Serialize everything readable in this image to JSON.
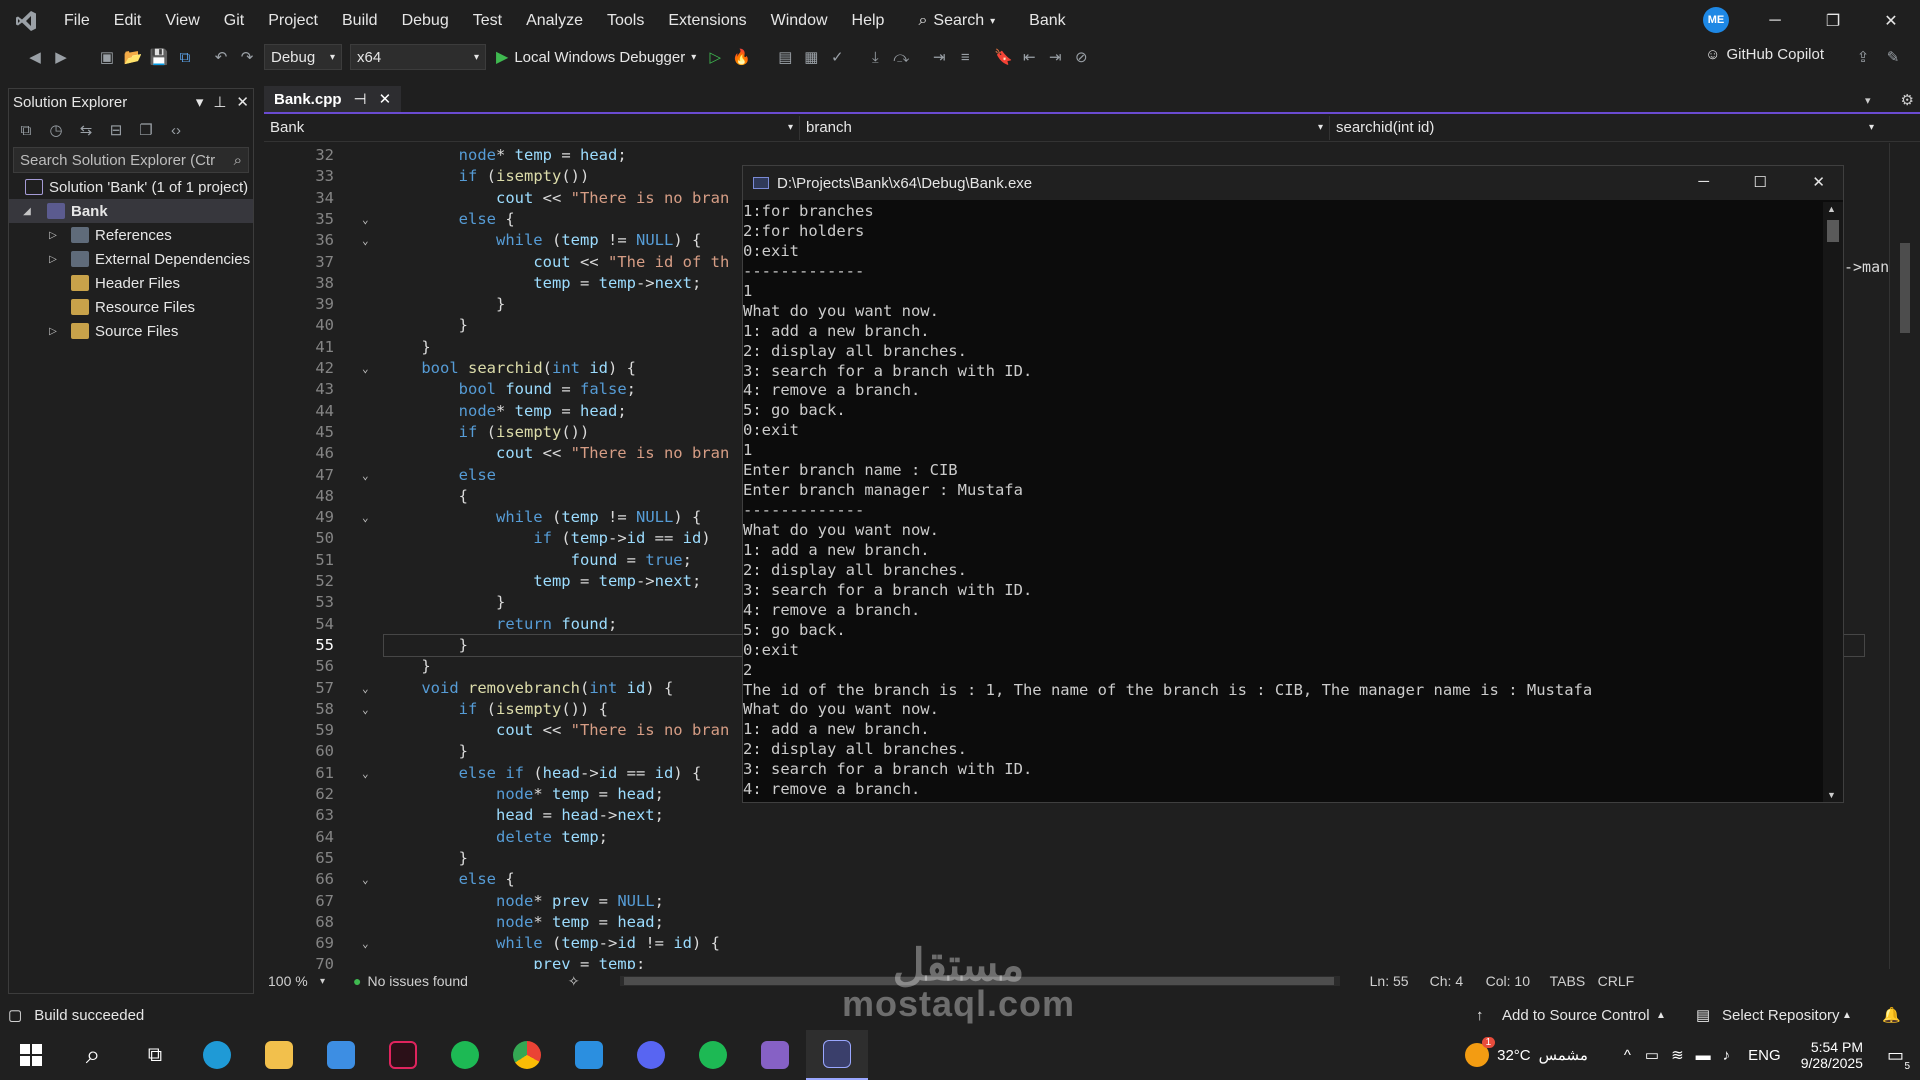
{
  "menu": {
    "items": [
      "File",
      "Edit",
      "View",
      "Git",
      "Project",
      "Build",
      "Debug",
      "Test",
      "Analyze",
      "Tools",
      "Extensions",
      "Window",
      "Help"
    ],
    "search_label": "Search",
    "app_title": "Bank",
    "avatar": "ME"
  },
  "toolbar": {
    "config": "Debug",
    "platform": "x64",
    "run_label": "Local Windows Debugger",
    "copilot": "GitHub Copilot"
  },
  "solution_explorer": {
    "title": "Solution Explorer",
    "search_placeholder": "Search Solution Explorer (Ctr",
    "solution": "Solution 'Bank' (1 of 1 project)",
    "project": "Bank",
    "items": [
      "References",
      "External Dependencies",
      "Header Files",
      "Resource Files",
      "Source Files"
    ]
  },
  "editor": {
    "tab": "Bank.cpp",
    "nav_scope": "Bank",
    "nav_class": "branch",
    "nav_member": "searchid(int id)",
    "lines": [
      {
        "n": "32",
        "t": "        node* temp = head;"
      },
      {
        "n": "33",
        "t": "        if (isempty())"
      },
      {
        "n": "34",
        "t": "            cout << \"There is no bran"
      },
      {
        "n": "35",
        "t": "        else {"
      },
      {
        "n": "36",
        "t": "            while (temp != NULL) {"
      },
      {
        "n": "37",
        "t": "                cout << \"The id of th"
      },
      {
        "n": "38",
        "t": "                temp = temp->next;"
      },
      {
        "n": "39",
        "t": "            }"
      },
      {
        "n": "40",
        "t": "        }"
      },
      {
        "n": "41",
        "t": "    }"
      },
      {
        "n": "42",
        "t": "    bool searchid(int id) {"
      },
      {
        "n": "43",
        "t": "        bool found = false;"
      },
      {
        "n": "44",
        "t": "        node* temp = head;"
      },
      {
        "n": "45",
        "t": "        if (isempty())"
      },
      {
        "n": "46",
        "t": "            cout << \"There is no bran"
      },
      {
        "n": "47",
        "t": "        else"
      },
      {
        "n": "48",
        "t": "        {"
      },
      {
        "n": "49",
        "t": "            while (temp != NULL) {"
      },
      {
        "n": "50",
        "t": "                if (temp->id == id)"
      },
      {
        "n": "51",
        "t": "                    found = true;"
      },
      {
        "n": "52",
        "t": "                temp = temp->next;"
      },
      {
        "n": "53",
        "t": "            }"
      },
      {
        "n": "54",
        "t": "            return found;"
      },
      {
        "n": "55",
        "t": "        }"
      },
      {
        "n": "56",
        "t": "    }"
      },
      {
        "n": "57",
        "t": "    void removebranch(int id) {"
      },
      {
        "n": "58",
        "t": "        if (isempty()) {"
      },
      {
        "n": "59",
        "t": "            cout << \"There is no bran"
      },
      {
        "n": "60",
        "t": "        }"
      },
      {
        "n": "61",
        "t": "        else if (head->id == id) {"
      },
      {
        "n": "62",
        "t": "            node* temp = head;"
      },
      {
        "n": "63",
        "t": "            head = head->next;"
      },
      {
        "n": "64",
        "t": "            delete temp;"
      },
      {
        "n": "65",
        "t": "        }"
      },
      {
        "n": "66",
        "t": "        else {"
      },
      {
        "n": "67",
        "t": "            node* prev = NULL;"
      },
      {
        "n": "68",
        "t": "            node* temp = head;"
      },
      {
        "n": "69",
        "t": "            while (temp->id != id) {"
      },
      {
        "n": "70",
        "t": "                prev = temp;"
      }
    ],
    "zoom": "100 %",
    "issues": "No issues found",
    "ln": "Ln: 55",
    "ch": "Ch: 4",
    "col": "Col: 10",
    "tabs": "TABS",
    "eol": "CRLF",
    "overflow_text": "->man"
  },
  "console": {
    "title": "D:\\Projects\\Bank\\x64\\Debug\\Bank.exe",
    "lines": [
      "1:for branches",
      "2:for holders",
      "0:exit",
      "-------------",
      "1",
      "What do you want now.",
      "1: add a new branch.",
      "2: display all branches.",
      "3: search for a branch with ID.",
      "4: remove a branch.",
      "5: go back.",
      "0:exit",
      "1",
      "Enter branch name : CIB",
      "Enter branch manager : Mustafa",
      "-------------",
      "What do you want now.",
      "1: add a new branch.",
      "2: display all branches.",
      "3: search for a branch with ID.",
      "4: remove a branch.",
      "5: go back.",
      "0:exit",
      "2",
      "The id of the branch is : 1, The name of the branch is : CIB, The manager name is : Mustafa",
      "What do you want now.",
      "1: add a new branch.",
      "2: display all branches.",
      "3: search for a branch with ID.",
      "4: remove a branch."
    ]
  },
  "statusbar": {
    "build": "Build succeeded",
    "source_control": "Add to Source Control",
    "repository": "Select Repository"
  },
  "taskbar": {
    "temp": "32°C",
    "weather": "مشمس",
    "lang": "ENG",
    "time": "5:54 PM",
    "date": "9/28/2025",
    "notifications": "5",
    "weather_badge": "1"
  },
  "watermark": {
    "arabic": "مستقل",
    "site": "mostaql.com"
  }
}
